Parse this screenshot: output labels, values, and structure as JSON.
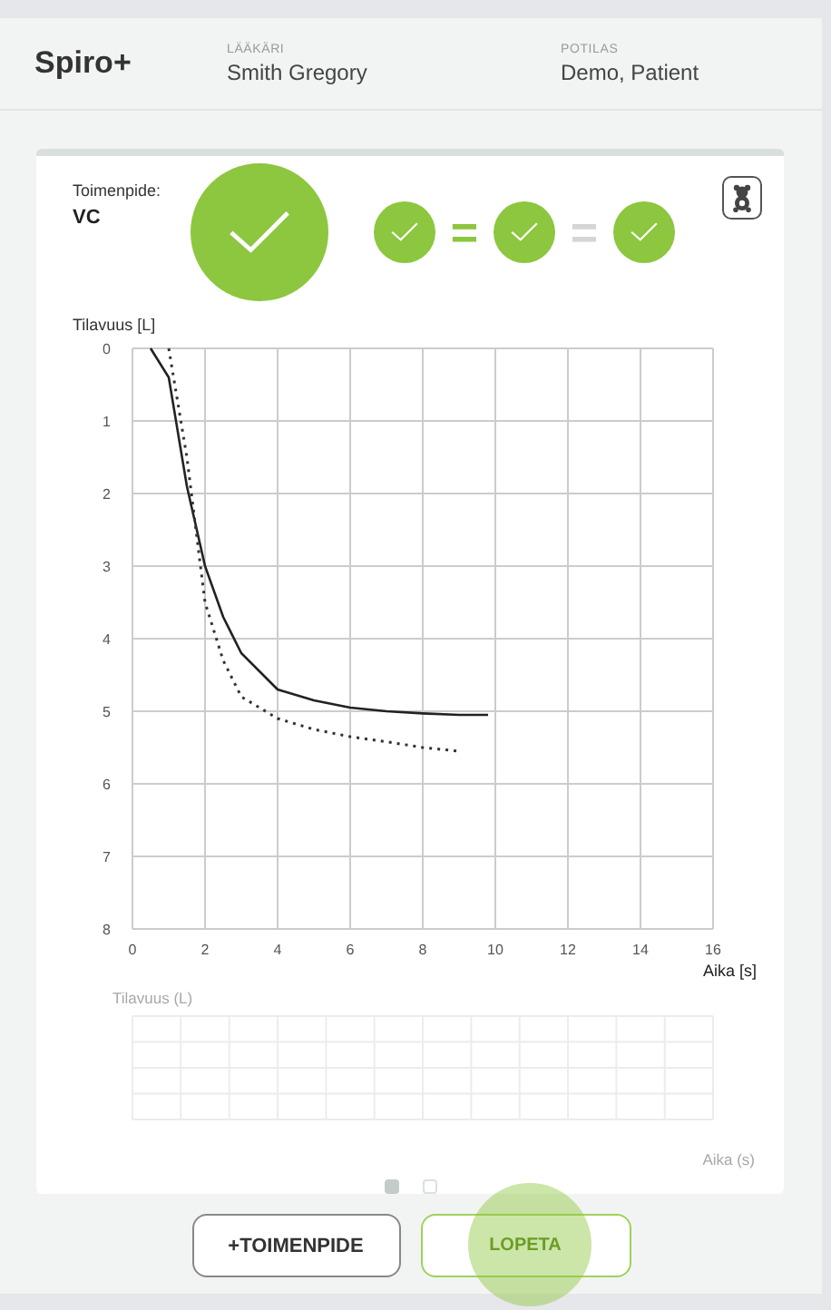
{
  "header": {
    "app_title": "Spiro+",
    "fields": [
      {
        "label": "LÄÄKÄRI",
        "value": "Smith Gregory"
      },
      {
        "label": "POTILAS",
        "value": "Demo, Patient"
      }
    ]
  },
  "procedure": {
    "label": "Toimenpide:",
    "value": "VC"
  },
  "overall": {
    "passed": true
  },
  "trials": [
    {
      "passed": true
    },
    {
      "passed": true
    },
    {
      "passed": true
    }
  ],
  "separators": [
    {
      "text": "=",
      "match": true
    },
    {
      "text": "=",
      "match": false
    }
  ],
  "child_mode": {
    "on": false
  },
  "chart_data": {
    "type": "line",
    "ylabel": "Tilavuus [L]",
    "xlabel": "Aika [s]",
    "xlim": [
      0,
      16
    ],
    "ylim": [
      8,
      0
    ],
    "xticks": [
      0,
      2,
      4,
      6,
      8,
      10,
      12,
      14,
      16
    ],
    "yticks": [
      0,
      1,
      2,
      3,
      4,
      5,
      6,
      7,
      8
    ],
    "x": [
      0.5,
      1,
      1.5,
      2,
      2.5,
      3,
      4,
      5,
      6,
      7,
      8,
      9,
      9.8
    ],
    "grid": true,
    "series": [
      {
        "line_style": "solid",
        "color": "#222222",
        "values": [
          0,
          0.4,
          1.9,
          3.0,
          3.7,
          4.2,
          4.7,
          4.85,
          4.95,
          5.0,
          5.03,
          5.05,
          5.05
        ]
      },
      {
        "line_style": "dotted",
        "color": "#333333",
        "values": [
          null,
          0,
          1.5,
          3.5,
          4.3,
          4.8,
          5.1,
          5.25,
          5.35,
          5.42,
          5.5,
          5.55,
          null
        ]
      }
    ]
  },
  "flow_chart": {
    "ylabel": "Tilavuus (L)",
    "xlabel": "Aika (s)"
  },
  "pages": [
    {
      "selected": true
    },
    {
      "selected": false
    }
  ],
  "buttons": [
    {
      "label": "+TOIMENPIDE",
      "kind": "outline",
      "touched": false
    },
    {
      "label": "LOPETA",
      "kind": "primary",
      "touched": true
    }
  ]
}
